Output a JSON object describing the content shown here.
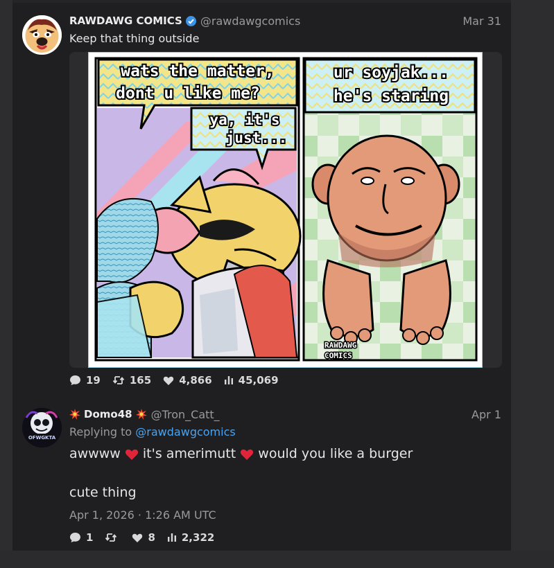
{
  "colors": {
    "accent": "#4aa3f0",
    "muted": "#9a9a9e",
    "heart": "#e0243a",
    "verified": "#3a93e8"
  },
  "posts": [
    {
      "author_name": "RAWDAWG COMICS",
      "verified": true,
      "handle": "@rawdawgcomics",
      "date": "Mar 31",
      "text": "Keep that thing outside",
      "media": {
        "panel_left_bubble_1": [
          "wats the matter,",
          "dont u like me?"
        ],
        "panel_left_bubble_2": [
          "ya, it's",
          "just..."
        ],
        "panel_right_caption": [
          "ur soyjak...",
          "he's staring"
        ],
        "signature": [
          "RAWDAWG",
          "COMICS"
        ]
      },
      "stats": {
        "replies": "19",
        "reposts": "165",
        "likes": "4,866",
        "views": "45,069"
      }
    },
    {
      "author_name": "Domo48",
      "name_emoji": "collision-icon",
      "handle": "@Tron_Catt_",
      "date": "Apr 1",
      "avatar_text": "OFWGKTA",
      "replying_prefix": "Replying to",
      "replying_to": "@rawdawgcomics",
      "text_part1": "awwww",
      "text_part2": "it's amerimutt",
      "text_part3": "would you like a burger",
      "text_line2": "cute thing",
      "timestamp": "Apr 1, 2026 · 1:26 AM UTC",
      "stats": {
        "replies": "1",
        "reposts": "",
        "likes": "8",
        "views": "2,322"
      }
    }
  ]
}
